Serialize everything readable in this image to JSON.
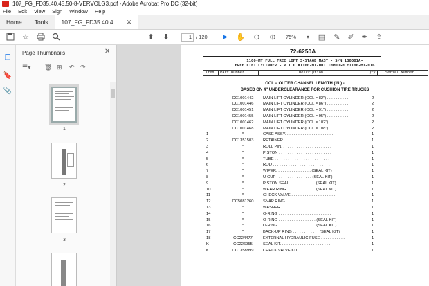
{
  "window": {
    "title": "107_FG_FD35.40.45.50-8-VERVOLG3.pdf - Adobe Acrobat Pro DC (32-bit)"
  },
  "menu": [
    "File",
    "Edit",
    "View",
    "Sign",
    "Window",
    "Help"
  ],
  "tabs": {
    "home": "Home",
    "tools": "Tools",
    "document": "107_FG_FD35.40.4..."
  },
  "toolbar": {
    "page_current": "1",
    "page_total": "/ 120",
    "zoom": "75%"
  },
  "panel": {
    "title": "Page Thumbnails",
    "thumbnails": [
      "1",
      "2",
      "3"
    ]
  },
  "document": {
    "doc_number": "72-6250A",
    "heading_line1": "1100-MT FULL FREE LIFT 3-STAGE MAST - S/N 130001A-",
    "heading_line2": "FREE LIFT CYLINDER - P.I.D #1100-MT-001 THROUGH F1100-MT-016",
    "columns": {
      "item": "Item",
      "part": "Part Number",
      "desc": "Description",
      "qty": "Qty",
      "serial": "Serial Number"
    },
    "ocl_line1": "OCL = OUTER CHANNEL LENGTH (IN.) -",
    "ocl_line2": "BASED ON 4\" UNDERCLEARANCE FOR CUSHION TIRE TRUCKS",
    "rows": [
      {
        "item": "",
        "part": "CC1001442",
        "desc": "MAIN LIFT CYLINDER (OCL = 82\") . . . . . . . . . .",
        "qty": "2"
      },
      {
        "item": "",
        "part": "CC1001446",
        "desc": "MAIN LIFT CYLINDER (OCL = 86\") . . . . . . . . . .",
        "qty": "2"
      },
      {
        "item": "",
        "part": "CC1001451",
        "desc": "MAIN LIFT CYLINDER (OCL = 91\") . . . . . . . . . .",
        "qty": "2"
      },
      {
        "item": "",
        "part": "CC1001455",
        "desc": "MAIN LIFT CYLINDER (OCL = 95\") . . . . . . . . . .",
        "qty": "2"
      },
      {
        "item": "",
        "part": "CC1001462",
        "desc": "MAIN LIFT CYLINDER (OCL = 102\") . . . . . . . . .",
        "qty": "2"
      },
      {
        "item": "",
        "part": "CC1001468",
        "desc": "MAIN LIFT CYLINDER (OCL = 108\") . . . . . . . . .",
        "qty": "2"
      },
      {
        "item": "1",
        "part": "*",
        "desc": "CASE ASSY. . . . . . . . . . . . . . . . . . . . . .",
        "qty": "1"
      },
      {
        "item": "2",
        "part": "CC1351503",
        "desc": "RETAINER . . . . . . . . . . . . . . . . . . . . . .",
        "qty": "1"
      },
      {
        "item": "3",
        "part": "*",
        "desc": "ROLL PIN. . . . . . . . . . . . . . . . . . . . . . .",
        "qty": "1"
      },
      {
        "item": "4",
        "part": "*",
        "desc": "PISTON . . . . . . . . . . . . . . . . . . . . . . . .",
        "qty": "1"
      },
      {
        "item": "5",
        "part": "*",
        "desc": "TUBE . . . . . . . . . . . . . . . . . . . . . . . . .",
        "qty": "1"
      },
      {
        "item": "6",
        "part": "*",
        "desc": "ROD . . . . . . . . . . . . . . . . . . . . . . . . . .",
        "qty": "1"
      },
      {
        "item": "7",
        "part": "*",
        "desc": "WIPER. . . . . . . . . . . . . . . . (SEAL KIT)",
        "qty": "1"
      },
      {
        "item": "8",
        "part": "*",
        "desc": "U-CUP . . . . . . . . . . . . . . . . (SEAL KIT)",
        "qty": "1"
      },
      {
        "item": "9",
        "part": "*",
        "desc": "PISTON SEAL. . . . . . . . . . . . (SEAL KIT)",
        "qty": "1"
      },
      {
        "item": "10",
        "part": "*",
        "desc": "WEAR RING . . . . . . . . . . . . . (SEAL KIT)",
        "qty": "1"
      },
      {
        "item": "11",
        "part": "*",
        "desc": "CHECK VALVE . . . . . . . . . . . . . . . . . . . .",
        "qty": "1"
      },
      {
        "item": "12",
        "part": "CC5081260",
        "desc": "SNAP RING. . . . . . . . . . . . . . . . . . . . . .",
        "qty": "1"
      },
      {
        "item": "13",
        "part": "*",
        "desc": "WASHER . . . . . . . . . . . . . . . . . . . . . . .",
        "qty": "1"
      },
      {
        "item": "14",
        "part": "*",
        "desc": "O-RING . . . . . . . . . . . . . . . . . . . . . . . .",
        "qty": "1"
      },
      {
        "item": "15",
        "part": "*",
        "desc": "O-RING . . . . . . . . . . . . . . . . . (SEAL KIT)",
        "qty": "1"
      },
      {
        "item": "16",
        "part": "*",
        "desc": "O-RING . . . . . . . . . . . . . . . . . (SEAL KIT)",
        "qty": "1"
      },
      {
        "item": "17",
        "part": "*",
        "desc": "BACK-UP RING . . . . . . . . . . . . (SEAL KIT)",
        "qty": "1"
      },
      {
        "item": "18",
        "part": "CC224477",
        "desc": "EXTERNAL HYDRAULIC FUSE . . . . . . . . . . .",
        "qty": "1"
      },
      {
        "item": "K",
        "part": "CC226955",
        "desc": "SEAL KIT. . . . . . . . . . . . . . . . . . . . . . .",
        "qty": "1"
      },
      {
        "item": "K",
        "part": "CC1358999",
        "desc": "CHECK VALVE KIT . . . . . . . . . . . . . . . . .",
        "qty": "1"
      }
    ]
  },
  "colors": {
    "accent": "#1473e6",
    "acrobat_red": "#d9251c"
  }
}
